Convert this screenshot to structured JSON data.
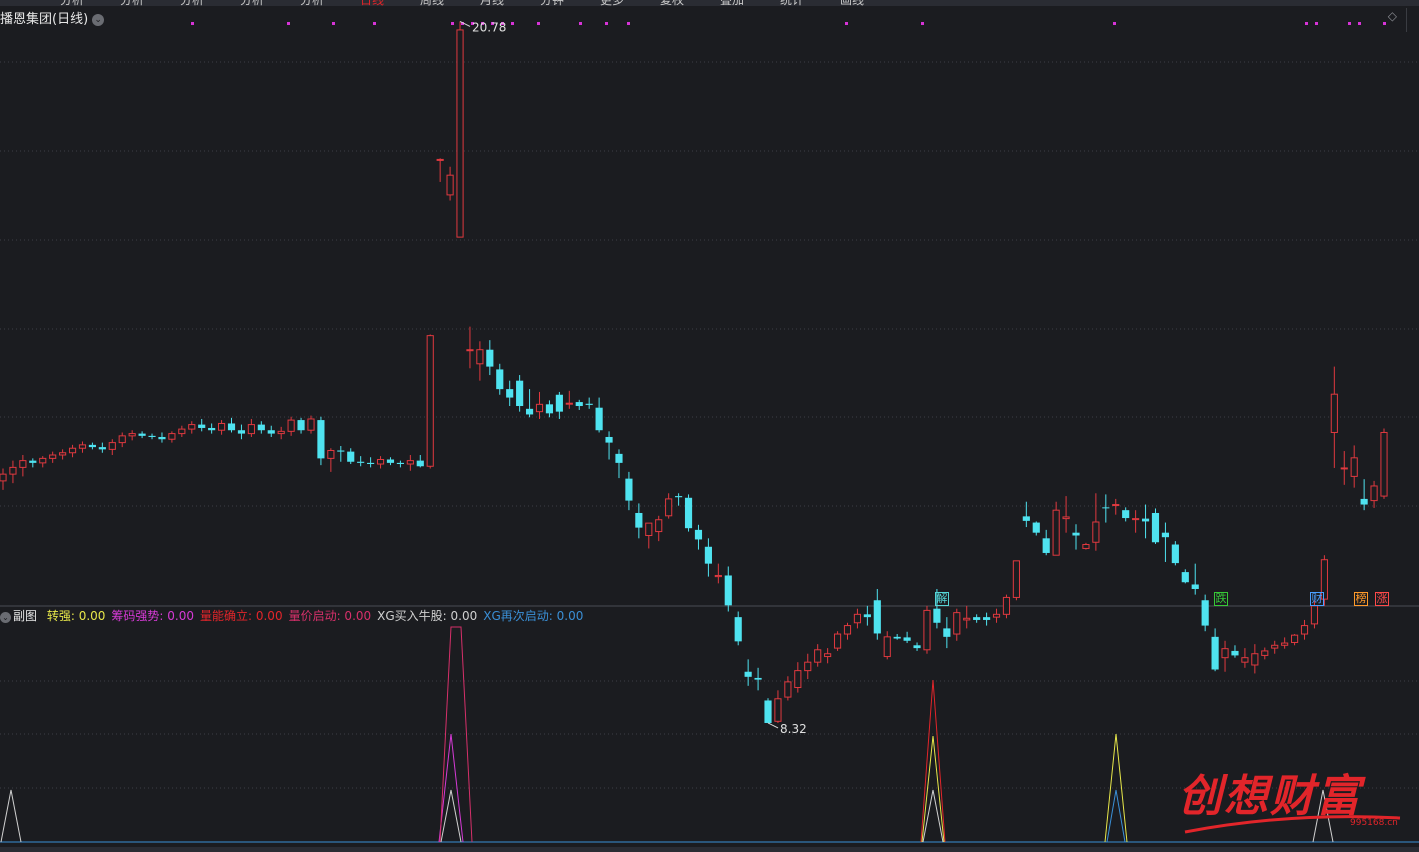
{
  "topbar_fragments": [
    {
      "text": "分析",
      "color": "#c8c8c8"
    },
    {
      "text": "分析",
      "color": "#c8c8c8"
    },
    {
      "text": "分析",
      "color": "#c8c8c8"
    },
    {
      "text": "分析",
      "color": "#c8c8c8"
    },
    {
      "text": "分析",
      "color": "#c8c8c8"
    },
    {
      "text": "日线",
      "color": "#e2252a"
    },
    {
      "text": "周线",
      "color": "#c8c8c8"
    },
    {
      "text": "月线",
      "color": "#c8c8c8"
    },
    {
      "text": "分钟",
      "color": "#c8c8c8"
    },
    {
      "text": "更多",
      "color": "#c8c8c8"
    },
    {
      "text": "复权",
      "color": "#c8c8c8"
    },
    {
      "text": "叠加",
      "color": "#c8c8c8"
    },
    {
      "text": "统计",
      "color": "#c8c8c8"
    },
    {
      "text": "画线",
      "color": "#c8c8c8"
    }
  ],
  "chart": {
    "title": "播恩集团(日线)",
    "high_label": "20.78",
    "low_label": "8.32",
    "up_color": "#e0393f",
    "down_color": "#4fe3f0"
  },
  "events": [
    {
      "char": "解",
      "color": "#56d6d6"
    },
    {
      "char": "跌",
      "color": "#37c837"
    },
    {
      "char": "财",
      "color": "#4aa0ff"
    },
    {
      "char": "榜",
      "color": "#ff9a2a"
    },
    {
      "char": "涨",
      "color": "#ff4a4a"
    }
  ],
  "subchart": {
    "name": "副图",
    "indicators": [
      {
        "label": "转强:",
        "value": "0.00",
        "color": "#e8e84a"
      },
      {
        "label": "筹码强势:",
        "value": "0.00",
        "color": "#d63ad6"
      },
      {
        "label": "量能确立:",
        "value": "0.00",
        "color": "#e2252a"
      },
      {
        "label": "量价启动:",
        "value": "0.00",
        "color": "#d6306a"
      },
      {
        "label": "XG买入牛股:",
        "value": "0.00",
        "color": "#d0d0d0"
      },
      {
        "label": "XG再次启动:",
        "value": "0.00",
        "color": "#3a8fd6"
      }
    ]
  },
  "watermark": {
    "text": "创想财富",
    "url": "995168.cn"
  },
  "chart_data": {
    "type": "candlestick",
    "title": "播恩集团(日线)",
    "annotations": {
      "max": 20.78,
      "min": 8.32
    },
    "ohlc": [
      [
        12.62,
        12.84,
        12.46,
        12.74
      ],
      [
        12.74,
        12.98,
        12.58,
        12.86
      ],
      [
        12.86,
        13.08,
        12.7,
        12.98
      ],
      [
        12.98,
        13.02,
        12.86,
        12.94
      ],
      [
        12.94,
        13.06,
        12.86,
        13.02
      ],
      [
        13.02,
        13.14,
        12.94,
        13.08
      ],
      [
        13.08,
        13.18,
        13.0,
        13.12
      ],
      [
        13.12,
        13.26,
        13.04,
        13.2
      ],
      [
        13.2,
        13.32,
        13.12,
        13.26
      ],
      [
        13.26,
        13.3,
        13.18,
        13.22
      ],
      [
        13.22,
        13.3,
        13.12,
        13.18
      ],
      [
        13.18,
        13.36,
        13.08,
        13.3
      ],
      [
        13.3,
        13.48,
        13.22,
        13.42
      ],
      [
        13.42,
        13.52,
        13.34,
        13.46
      ],
      [
        13.46,
        13.5,
        13.38,
        13.42
      ],
      [
        13.42,
        13.46,
        13.36,
        13.4
      ],
      [
        13.4,
        13.48,
        13.3,
        13.36
      ],
      [
        13.36,
        13.5,
        13.3,
        13.46
      ],
      [
        13.46,
        13.6,
        13.4,
        13.54
      ],
      [
        13.54,
        13.68,
        13.46,
        13.62
      ],
      [
        13.62,
        13.72,
        13.5,
        13.56
      ],
      [
        13.56,
        13.64,
        13.46,
        13.52
      ],
      [
        13.52,
        13.7,
        13.44,
        13.64
      ],
      [
        13.64,
        13.74,
        13.48,
        13.52
      ],
      [
        13.52,
        13.62,
        13.36,
        13.46
      ],
      [
        13.46,
        13.72,
        13.4,
        13.62
      ],
      [
        13.62,
        13.68,
        13.46,
        13.52
      ],
      [
        13.52,
        13.6,
        13.4,
        13.46
      ],
      [
        13.46,
        13.58,
        13.36,
        13.5
      ],
      [
        13.5,
        13.76,
        13.42,
        13.7
      ],
      [
        13.7,
        13.74,
        13.46,
        13.52
      ],
      [
        13.52,
        13.78,
        13.46,
        13.72
      ],
      [
        13.7,
        13.76,
        12.9,
        13.02
      ],
      [
        13.02,
        13.2,
        12.78,
        13.16
      ],
      [
        13.16,
        13.24,
        12.96,
        13.14
      ],
      [
        13.14,
        13.2,
        12.92,
        12.96
      ],
      [
        12.96,
        13.06,
        12.88,
        12.94
      ],
      [
        12.94,
        13.04,
        12.86,
        12.92
      ],
      [
        12.92,
        13.06,
        12.84,
        13.0
      ],
      [
        13.0,
        13.04,
        12.9,
        12.94
      ],
      [
        12.94,
        12.98,
        12.86,
        12.92
      ],
      [
        12.92,
        13.08,
        12.8,
        12.98
      ],
      [
        12.98,
        13.08,
        12.86,
        12.88
      ],
      [
        12.88,
        15.22,
        12.84,
        15.2
      ],
      [
        18.33,
        18.35,
        17.93,
        18.33
      ],
      [
        17.7,
        18.2,
        17.6,
        18.05
      ],
      [
        16.95,
        20.78,
        16.95,
        20.63
      ],
      [
        14.95,
        15.36,
        14.62,
        14.95
      ],
      [
        14.7,
        15.1,
        14.4,
        14.95
      ],
      [
        14.95,
        15.12,
        14.5,
        14.65
      ],
      [
        14.6,
        14.7,
        14.15,
        14.25
      ],
      [
        14.25,
        14.4,
        13.95,
        14.1
      ],
      [
        14.4,
        14.5,
        13.85,
        13.95
      ],
      [
        13.9,
        14.25,
        13.75,
        13.8
      ],
      [
        13.85,
        14.2,
        13.72,
        13.98
      ],
      [
        13.98,
        14.05,
        13.75,
        13.82
      ],
      [
        14.15,
        14.2,
        13.72,
        13.85
      ],
      [
        14.0,
        14.22,
        13.9,
        14.0
      ],
      [
        14.02,
        14.06,
        13.88,
        13.95
      ],
      [
        13.99,
        14.1,
        13.9,
        13.97
      ],
      [
        13.92,
        14.1,
        13.48,
        13.52
      ],
      [
        13.4,
        13.5,
        13.0,
        13.3
      ],
      [
        13.1,
        13.18,
        12.67,
        12.94
      ],
      [
        12.66,
        12.78,
        12.1,
        12.27
      ],
      [
        12.05,
        12.22,
        11.6,
        11.79
      ],
      [
        11.65,
        11.85,
        11.42,
        11.87
      ],
      [
        11.72,
        12.0,
        11.55,
        11.93
      ],
      [
        12.0,
        12.4,
        11.95,
        12.3
      ],
      [
        12.35,
        12.4,
        12.18,
        12.33
      ],
      [
        12.32,
        12.38,
        11.72,
        11.78
      ],
      [
        11.75,
        11.84,
        11.4,
        11.58
      ],
      [
        11.45,
        11.6,
        10.92,
        11.15
      ],
      [
        10.92,
        11.15,
        10.8,
        10.94
      ],
      [
        10.94,
        11.1,
        10.3,
        10.41
      ],
      [
        10.2,
        10.3,
        9.7,
        9.77
      ],
      [
        9.23,
        9.45,
        8.98,
        9.14
      ],
      [
        9.12,
        9.3,
        8.9,
        9.09
      ],
      [
        8.72,
        8.76,
        8.32,
        8.32
      ],
      [
        8.35,
        8.9,
        8.32,
        8.75
      ],
      [
        8.78,
        9.15,
        8.72,
        9.05
      ],
      [
        8.95,
        9.4,
        8.86,
        9.25
      ],
      [
        9.25,
        9.55,
        9.1,
        9.4
      ],
      [
        9.4,
        9.72,
        9.32,
        9.62
      ],
      [
        9.5,
        9.65,
        9.38,
        9.55
      ],
      [
        9.65,
        9.95,
        9.6,
        9.9
      ],
      [
        9.9,
        10.1,
        9.8,
        10.05
      ],
      [
        10.1,
        10.35,
        10.0,
        10.25
      ],
      [
        10.25,
        10.4,
        10.05,
        10.2
      ],
      [
        10.5,
        10.7,
        9.8,
        9.91
      ],
      [
        9.5,
        9.95,
        9.45,
        9.85
      ],
      [
        9.85,
        9.9,
        9.8,
        9.82
      ],
      [
        9.84,
        9.94,
        9.74,
        9.78
      ],
      [
        9.7,
        9.75,
        9.6,
        9.65
      ],
      [
        9.62,
        10.4,
        9.55,
        10.32
      ],
      [
        10.35,
        10.7,
        10.0,
        10.1
      ],
      [
        10.0,
        10.2,
        9.65,
        9.85
      ],
      [
        9.9,
        10.35,
        9.78,
        10.28
      ],
      [
        10.15,
        10.4,
        10.0,
        10.18
      ],
      [
        10.2,
        10.25,
        10.1,
        10.15
      ],
      [
        10.2,
        10.28,
        10.05,
        10.15
      ],
      [
        10.2,
        10.35,
        10.1,
        10.25
      ],
      [
        10.25,
        10.6,
        10.18,
        10.55
      ],
      [
        10.55,
        11.2,
        10.5,
        11.2
      ],
      [
        11.99,
        12.25,
        11.8,
        11.91
      ],
      [
        11.88,
        11.9,
        11.65,
        11.7
      ],
      [
        11.6,
        11.75,
        11.3,
        11.34
      ],
      [
        11.3,
        12.25,
        11.3,
        12.1
      ],
      [
        11.95,
        12.35,
        11.7,
        11.98
      ],
      [
        11.7,
        11.85,
        11.4,
        11.65
      ],
      [
        11.42,
        11.52,
        11.4,
        11.49
      ],
      [
        11.53,
        12.4,
        11.38,
        11.89
      ],
      [
        12.15,
        12.38,
        11.88,
        12.14
      ],
      [
        12.2,
        12.3,
        12.02,
        12.2
      ],
      [
        12.1,
        12.15,
        11.9,
        11.96
      ],
      [
        11.95,
        12.1,
        11.7,
        11.95
      ],
      [
        11.95,
        12.2,
        11.6,
        11.9
      ],
      [
        12.05,
        12.13,
        11.5,
        11.53
      ],
      [
        11.7,
        11.88,
        11.18,
        11.62
      ],
      [
        11.49,
        11.55,
        11.12,
        11.16
      ],
      [
        11.0,
        11.05,
        10.8,
        10.82
      ],
      [
        10.78,
        11.15,
        10.6,
        10.7
      ],
      [
        10.5,
        10.6,
        9.95,
        10.05
      ],
      [
        9.85,
        10.0,
        9.24,
        9.27
      ],
      [
        9.48,
        9.78,
        9.23,
        9.64
      ],
      [
        9.6,
        9.7,
        9.48,
        9.52
      ],
      [
        9.4,
        9.65,
        9.3,
        9.48
      ],
      [
        9.35,
        9.72,
        9.2,
        9.55
      ],
      [
        9.52,
        9.66,
        9.45,
        9.6
      ],
      [
        9.65,
        9.78,
        9.55,
        9.7
      ],
      [
        9.7,
        9.84,
        9.64,
        9.74
      ],
      [
        9.75,
        9.9,
        9.7,
        9.88
      ],
      [
        9.9,
        10.15,
        9.8,
        10.05
      ],
      [
        10.08,
        10.5,
        10.0,
        10.4
      ],
      [
        10.52,
        11.3,
        10.4,
        11.22
      ],
      [
        13.48,
        14.65,
        12.85,
        14.16
      ],
      [
        12.85,
        13.15,
        12.55,
        12.85
      ],
      [
        12.7,
        13.25,
        12.5,
        13.03
      ],
      [
        12.3,
        12.65,
        12.1,
        12.2
      ],
      [
        12.27,
        12.62,
        12.14,
        12.53
      ],
      [
        12.35,
        13.55,
        12.3,
        13.48
      ]
    ],
    "subchart_series": [
      "转强",
      "筹码强势",
      "量能确立",
      "量价启动",
      "XG买入牛股",
      "XG再次启动"
    ]
  }
}
